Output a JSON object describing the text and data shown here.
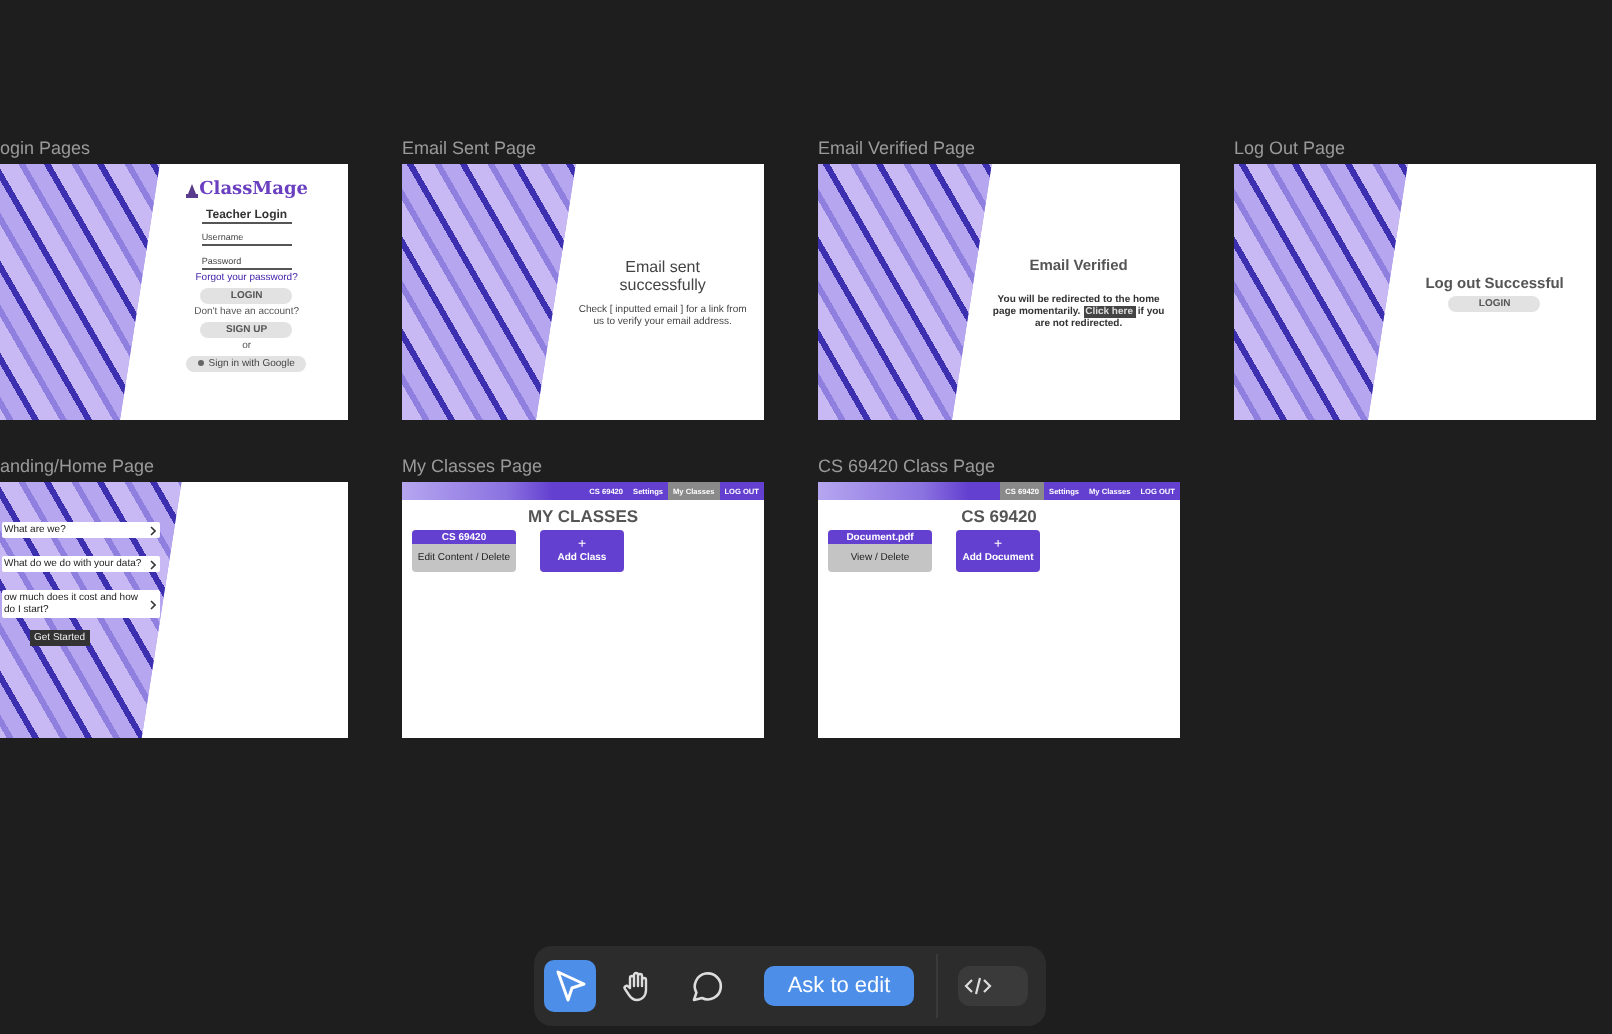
{
  "canvas": {
    "frames": [
      {
        "kind": "login",
        "title": "ogin Pages",
        "logo": "ClassMage",
        "heading": "Teacher Login",
        "fields": [
          {
            "placeholder": "Username"
          },
          {
            "placeholder": "Password"
          }
        ],
        "link": "Forgot your password?",
        "login_button": "LOGIN",
        "note": "Don't have an account?",
        "signup_button": "SIGN UP",
        "separator": "or",
        "google_button": "Sign in with Google"
      },
      {
        "kind": "message",
        "title": "Email Sent Page",
        "heading": "Email sent successfully",
        "text": "Check [ inputted email ] for a link from us to verify your email address."
      },
      {
        "kind": "verified",
        "title": "Email Verified Page",
        "heading": "Email Verified",
        "text_before": "You will be redirected to the home page momentarily.",
        "link": "Click here",
        "text_after": "if you are not redirected."
      },
      {
        "kind": "logout",
        "title": "Log Out Page",
        "heading": "Log out Successful",
        "button": "LOGIN"
      },
      {
        "kind": "landing",
        "title": "anding/Home Page",
        "faq": [
          "What are we?",
          "What do we do with your data?",
          "ow much does it cost and how do I start?"
        ],
        "button": "Get Started"
      },
      {
        "kind": "classes",
        "title": "My Classes Page",
        "nav": [
          {
            "label": "CS 69420",
            "selected": false
          },
          {
            "label": "Settings",
            "selected": false
          },
          {
            "label": "My Classes",
            "selected": true
          },
          {
            "label": "LOG OUT",
            "selected": false
          }
        ],
        "heading": "MY CLASSES",
        "cards": [
          {
            "title": "CS 69420",
            "actions": "Edit Content / Delete"
          }
        ],
        "add": {
          "icon": "+",
          "label": "Add Class"
        }
      },
      {
        "kind": "classes",
        "title": "CS 69420 Class Page",
        "nav": [
          {
            "label": "CS 69420",
            "selected": true
          },
          {
            "label": "Settings",
            "selected": false
          },
          {
            "label": "My Classes",
            "selected": false
          },
          {
            "label": "LOG OUT",
            "selected": false
          }
        ],
        "heading": "CS 69420",
        "cards": [
          {
            "title": "Document.pdf",
            "actions": "View / Delete"
          }
        ],
        "add": {
          "icon": "+",
          "label": "Add Document"
        }
      }
    ]
  },
  "toolbar": {
    "tools": [
      {
        "kind": "pointer",
        "selected": true
      },
      {
        "kind": "hand",
        "selected": false
      },
      {
        "kind": "comment",
        "selected": false
      }
    ],
    "button": "Ask to edit",
    "code_toggle": {
      "on": false
    }
  }
}
